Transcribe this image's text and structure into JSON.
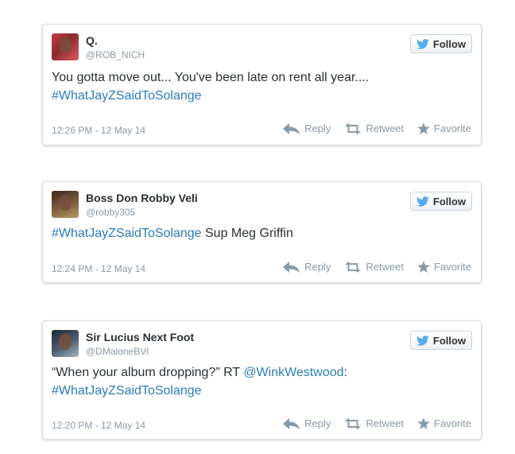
{
  "colors": {
    "link": "#2b7bb9",
    "meta": "#8899a6",
    "text": "#292f33",
    "bird": "#55acee"
  },
  "tweets": [
    {
      "name": "Q.",
      "handle": "@ROB_NICH",
      "follow_label": "Follow",
      "text_parts": [
        "You gotta move out... You've been late on rent all year....",
        "#WhatJayZSaidToSolange"
      ],
      "timestamp": "12:26 PM - 12 May 14",
      "actions": {
        "reply": "Reply",
        "retweet": "Retweet",
        "favorite": "Favorite"
      }
    },
    {
      "name": "Boss Don Robby Veli",
      "handle": "@robby305",
      "follow_label": "Follow",
      "text_parts": [
        "#WhatJayZSaidToSolange",
        " Sup Meg Griffin"
      ],
      "timestamp": "12:24 PM - 12 May 14",
      "actions": {
        "reply": "Reply",
        "retweet": "Retweet",
        "favorite": "Favorite"
      }
    },
    {
      "name": "Sir Lucius Next Foot",
      "handle": "@DMaloneBVI",
      "follow_label": "Follow",
      "text_parts": [
        "“When your album dropping?” RT ",
        "@WinkWestwood",
        ":",
        "#WhatJayZSaidToSolange"
      ],
      "timestamp": "12:20 PM - 12 May 14",
      "actions": {
        "reply": "Reply",
        "retweet": "Retweet",
        "favorite": "Favorite"
      }
    }
  ]
}
